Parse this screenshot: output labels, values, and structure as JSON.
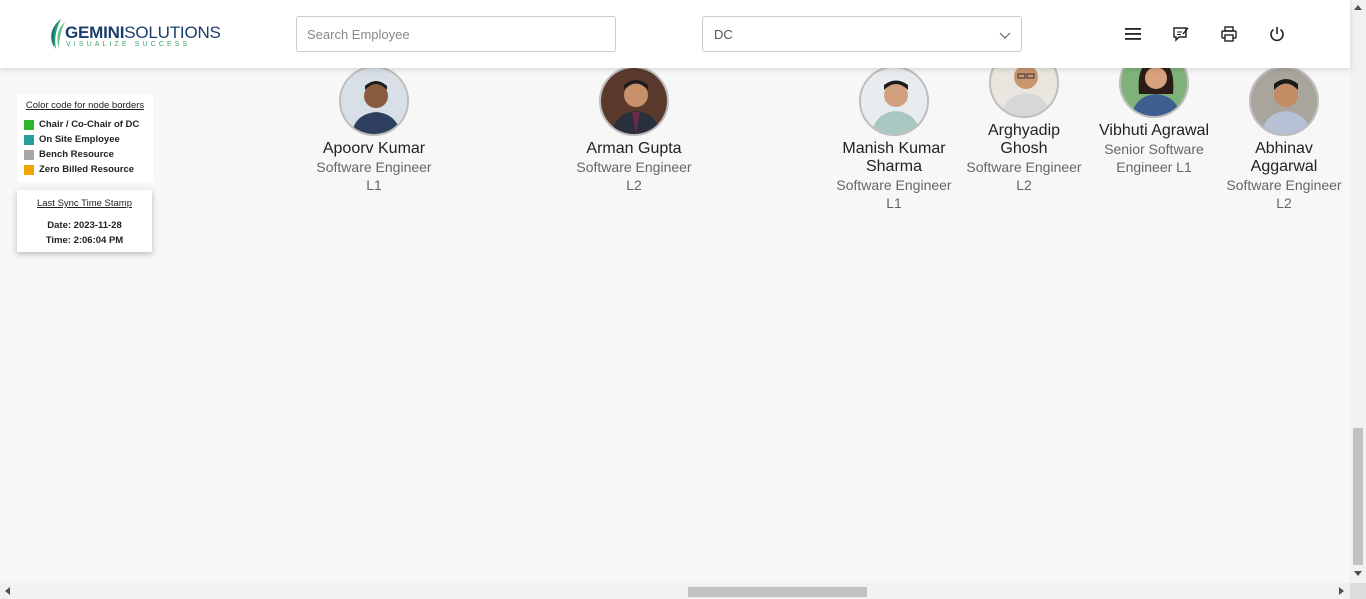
{
  "header": {
    "logo_text_bold": "GEMINI",
    "logo_text_light": "SOLUTIONS",
    "logo_tagline": "VISUALIZE SUCCESS",
    "search_placeholder": "Search Employee",
    "search_value": "",
    "department_selected": "DC",
    "icons": [
      "menu-icon",
      "feedback-icon",
      "print-icon",
      "power-icon"
    ]
  },
  "legend": {
    "title": "Color code for node borders",
    "items": [
      {
        "label": "Chair / Co-Chair of DC",
        "color": "#2db52d"
      },
      {
        "label": "On Site Employee",
        "color": "#2a9d9d"
      },
      {
        "label": "Bench Resource",
        "color": "#a6a6a6"
      },
      {
        "label": "Zero Billed Resource",
        "color": "#f0a500"
      }
    ]
  },
  "sync": {
    "title": "Last Sync Time Stamp",
    "date": "Date: 2023-11-28",
    "time": "Time: 2:06:04 PM"
  },
  "employees": [
    {
      "name": "Apoorv Kumar",
      "role": "Software Engineer L1"
    },
    {
      "name": "Arman Gupta",
      "role": "Software Engineer L2"
    },
    {
      "name": "Manish Kumar Sharma",
      "role": "Software Engineer L1"
    },
    {
      "name": "Arghyadip Ghosh",
      "role": "Software Engineer L2"
    },
    {
      "name": "Vibhuti Agrawal",
      "role": "Senior Software Engineer L1"
    },
    {
      "name": "Abhinav Aggarwal",
      "role": "Software Engineer L2"
    }
  ],
  "colors": {
    "accent": "#1d3d6b",
    "leaf": "#3aa56a",
    "background": "#f7f7f7"
  }
}
